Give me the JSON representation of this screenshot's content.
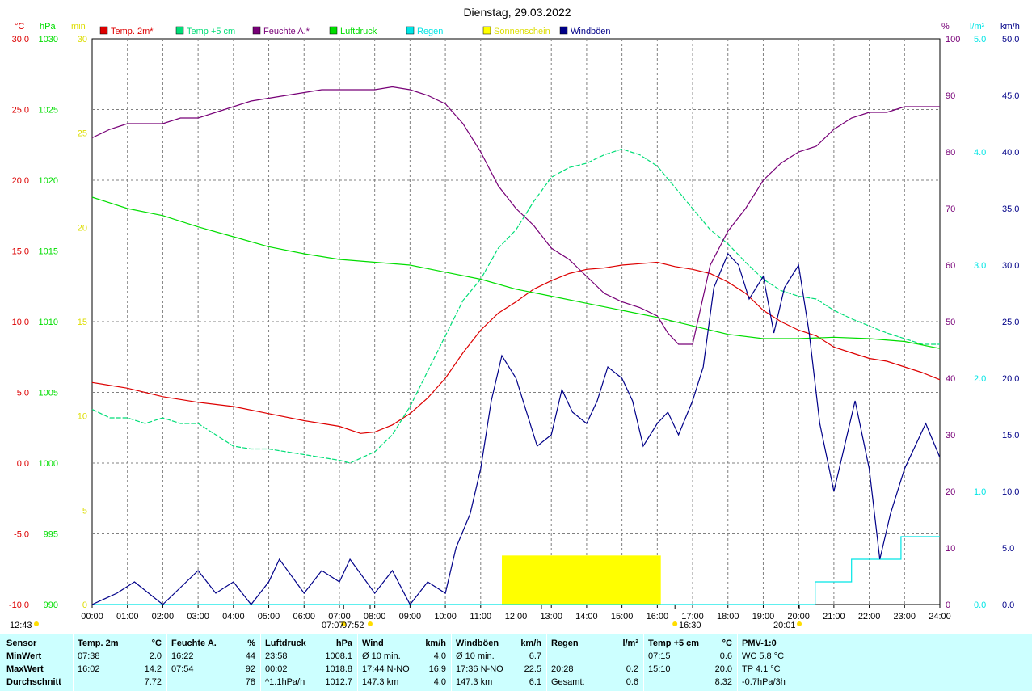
{
  "title": "Dienstag, 29.03.2022",
  "colors": {
    "temp2m": "#dd0000",
    "temp5cm": "#00dd77",
    "humidity": "#770077",
    "pressure": "#00dd00",
    "rain": "#00e5e5",
    "sunshine": "#ffff00",
    "gusts": "#000088",
    "grid": "#808080"
  },
  "axis_labels": {
    "temp_unit": "°C",
    "pressure_unit": "hPa",
    "sun_unit": "min",
    "hum_unit": "%",
    "rain_unit": "l/m²",
    "wind_unit": "km/h"
  },
  "legend": [
    {
      "label": "Temp. 2m*",
      "color": "#dd0000"
    },
    {
      "label": "Temp +5 cm",
      "color": "#00dd77"
    },
    {
      "label": "Feuchte A.*",
      "color": "#770077"
    },
    {
      "label": "Luftdruck",
      "color": "#00dd00"
    },
    {
      "label": "Regen",
      "color": "#00e5e5"
    },
    {
      "label": "Sonnenschein",
      "color": "#ffff00"
    },
    {
      "label": "Windböen",
      "color": "#000088"
    }
  ],
  "ticks": {
    "temp": [
      "30.0",
      "25.0",
      "20.0",
      "15.0",
      "10.0",
      "5.0",
      "0.0",
      "-5.0",
      "-10.0"
    ],
    "pressure": [
      "1030",
      "1025",
      "1020",
      "1015",
      "1010",
      "1005",
      "1000",
      "995",
      "990"
    ],
    "sun": [
      "30",
      "25",
      "20",
      "15",
      "10",
      "5",
      "0"
    ],
    "hum": [
      "100",
      "90",
      "80",
      "70",
      "60",
      "50",
      "40",
      "30",
      "20",
      "10",
      "0"
    ],
    "rain": [
      "5.0",
      "4.0",
      "3.0",
      "2.0",
      "1.0",
      "0.0"
    ],
    "wind": [
      "50.0",
      "45.0",
      "40.0",
      "35.0",
      "30.0",
      "25.0",
      "20.0",
      "15.0",
      "10.0",
      "5.0",
      "0.0"
    ],
    "x": [
      "00:00",
      "01:00",
      "02:00",
      "03:00",
      "04:00",
      "05:00",
      "06:00",
      "07:00",
      "08:00",
      "09:00",
      "10:00",
      "11:00",
      "12:00",
      "13:00",
      "14:00",
      "15:00",
      "16:00",
      "17:00",
      "18:00",
      "19:00",
      "20:00",
      "21:00",
      "22:00",
      "23:00",
      "24:00"
    ]
  },
  "markers": [
    {
      "label": "12:43",
      "hour": 12.72
    },
    {
      "label": "07:07",
      "hour": 7.12
    },
    {
      "label": "07:52",
      "hour": 7.87
    },
    {
      "label": "16:30",
      "hour": 16.5
    },
    {
      "label": "20:01",
      "hour": 20.02
    }
  ],
  "chart_data": {
    "type": "line",
    "title": "Dienstag, 29.03.2022",
    "x_unit": "hour of day",
    "xlim": [
      0,
      24
    ],
    "series": [
      {
        "name": "Temp. 2m*",
        "axis": "temp",
        "ylim": [
          -10,
          30
        ],
        "x": [
          0,
          1,
          2,
          3,
          4,
          5,
          6,
          7,
          7.6,
          8,
          8.5,
          9,
          9.5,
          10,
          10.5,
          11,
          11.5,
          12,
          12.5,
          13,
          13.5,
          14,
          14.5,
          15,
          15.5,
          16,
          16.5,
          17,
          17.5,
          18,
          18.5,
          19,
          19.5,
          20,
          20.5,
          21,
          21.5,
          22,
          22.5,
          23,
          23.5,
          24
        ],
        "y": [
          5.7,
          5.3,
          4.7,
          4.3,
          4.0,
          3.5,
          3.0,
          2.6,
          2.1,
          2.2,
          2.7,
          3.5,
          4.6,
          6.0,
          7.8,
          9.4,
          10.6,
          11.4,
          12.3,
          12.9,
          13.4,
          13.7,
          13.8,
          14.0,
          14.1,
          14.2,
          13.9,
          13.7,
          13.4,
          12.8,
          12.0,
          10.8,
          10.0,
          9.4,
          9.0,
          8.2,
          7.8,
          7.4,
          7.2,
          6.8,
          6.4,
          5.9
        ]
      },
      {
        "name": "Temp +5 cm",
        "axis": "temp",
        "ylim": [
          -10,
          30
        ],
        "x": [
          0,
          0.5,
          1,
          1.5,
          2,
          2.5,
          3,
          3.5,
          4,
          4.5,
          5,
          5.5,
          6,
          6.5,
          7,
          7.3,
          8,
          8.5,
          9,
          9.5,
          10,
          10.5,
          11,
          11.5,
          12,
          12.5,
          13,
          13.5,
          14,
          14.5,
          15,
          15.5,
          16,
          16.5,
          17,
          17.5,
          18,
          18.5,
          19,
          19.5,
          20,
          20.5,
          21,
          21.5,
          22,
          22.5,
          23,
          23.5,
          24
        ],
        "y": [
          3.8,
          3.2,
          3.2,
          2.8,
          3.2,
          2.8,
          2.8,
          2.0,
          1.2,
          1.0,
          1.0,
          0.8,
          0.6,
          0.4,
          0.2,
          0.0,
          0.8,
          2.0,
          4.0,
          6.5,
          9.0,
          11.5,
          13.0,
          15.2,
          16.5,
          18.5,
          20.2,
          20.9,
          21.2,
          21.8,
          22.2,
          21.8,
          21.0,
          19.5,
          18.0,
          16.5,
          15.5,
          14.2,
          13.0,
          12.2,
          11.8,
          11.6,
          10.8,
          10.2,
          9.7,
          9.2,
          8.8,
          8.4,
          8.4
        ]
      },
      {
        "name": "Feuchte A.*",
        "axis": "hum",
        "ylim": [
          0,
          100
        ],
        "x": [
          0,
          0.5,
          1,
          1.5,
          2,
          2.5,
          3,
          3.5,
          4,
          4.5,
          5,
          5.5,
          6,
          6.5,
          7,
          7.5,
          8,
          8.5,
          9,
          9.5,
          10,
          10.5,
          11,
          11.5,
          12,
          12.5,
          13,
          13.5,
          14,
          14.5,
          15,
          15.5,
          16,
          16.3,
          16.6,
          17,
          17.5,
          18,
          18.5,
          19,
          19.5,
          20,
          20.5,
          21,
          21.5,
          22,
          22.5,
          23,
          23.5,
          24
        ],
        "y": [
          82.5,
          84,
          85,
          85,
          85,
          86,
          86,
          87,
          88,
          89,
          89.5,
          90,
          90.5,
          91,
          91,
          91,
          91,
          91.5,
          91,
          90,
          88.5,
          85,
          80,
          74,
          70,
          67,
          63,
          61,
          58,
          55,
          53.5,
          52.5,
          51,
          48,
          46,
          46,
          60,
          66,
          70,
          75,
          78,
          80,
          81,
          84,
          86,
          87,
          87,
          88,
          88,
          88
        ]
      },
      {
        "name": "Luftdruck",
        "axis": "pressure",
        "ylim": [
          990,
          1030
        ],
        "x": [
          0,
          1,
          2,
          3,
          4,
          5,
          6,
          7,
          8,
          9,
          10,
          11,
          12,
          13,
          14,
          15,
          16,
          17,
          18,
          19,
          20,
          21,
          22,
          23,
          24
        ],
        "y": [
          1018.8,
          1018.0,
          1017.5,
          1016.7,
          1016.0,
          1015.3,
          1014.8,
          1014.4,
          1014.2,
          1014.0,
          1013.5,
          1013.0,
          1012.3,
          1011.8,
          1011.3,
          1010.8,
          1010.3,
          1009.7,
          1009.1,
          1008.8,
          1008.8,
          1008.9,
          1008.8,
          1008.6,
          1008.1
        ]
      },
      {
        "name": "Regen",
        "axis": "rain",
        "ylim": [
          0,
          5
        ],
        "x": [
          0,
          20.47,
          20.47,
          21.5,
          21.5,
          22.9,
          22.9,
          24
        ],
        "y": [
          0,
          0,
          0.2,
          0.2,
          0.4,
          0.4,
          0.6,
          0.6
        ]
      },
      {
        "name": "Windböen",
        "axis": "wind",
        "ylim": [
          0,
          50
        ],
        "x": [
          0,
          0.7,
          1.2,
          2,
          3,
          3.5,
          4,
          4.5,
          5,
          5.3,
          6,
          6.5,
          7,
          7.3,
          8,
          8.5,
          9,
          9.5,
          10,
          10.3,
          10.7,
          11,
          11.3,
          11.6,
          12,
          12.3,
          12.6,
          13,
          13.3,
          13.6,
          14,
          14.3,
          14.6,
          15,
          15.3,
          15.6,
          16,
          16.3,
          16.6,
          17,
          17.3,
          17.6,
          18,
          18.3,
          18.6,
          19,
          19.3,
          19.6,
          20,
          20.3,
          20.6,
          21,
          21.3,
          21.6,
          22,
          22.3,
          22.6,
          23,
          23.3,
          23.6,
          24
        ],
        "y": [
          0,
          1,
          2,
          0,
          3,
          1,
          2,
          0,
          2,
          4,
          1,
          3,
          2,
          4,
          1,
          3,
          0,
          2,
          1,
          5,
          8,
          12,
          18,
          22,
          20,
          17,
          14,
          15,
          19,
          17,
          16,
          18,
          21,
          20,
          18,
          14,
          16,
          17,
          15,
          18,
          21,
          28,
          31,
          30,
          27,
          29,
          24,
          28,
          30,
          24,
          16,
          10,
          14,
          18,
          12,
          4,
          8,
          12,
          14,
          16,
          13
        ]
      },
      {
        "name": "Sonnenschein",
        "axis": "sun",
        "ylim": [
          0,
          30
        ],
        "x": [
          11.6,
          16.1
        ],
        "y": [
          2.6,
          2.6
        ]
      }
    ]
  },
  "stats": {
    "columns": [
      {
        "header": [
          "Sensor",
          ""
        ],
        "rows": [
          [
            "MinWert",
            ""
          ],
          [
            "MaxWert",
            ""
          ],
          [
            "Durchschnitt",
            ""
          ]
        ]
      },
      {
        "header": [
          "Temp. 2m",
          "°C"
        ],
        "rows": [
          [
            "07:38",
            "2.0"
          ],
          [
            "16:02",
            "14.2"
          ],
          [
            "",
            "7.72"
          ]
        ]
      },
      {
        "header": [
          "Feuchte A.",
          "%"
        ],
        "rows": [
          [
            "16:22",
            "44"
          ],
          [
            "07:54",
            "92"
          ],
          [
            "",
            "78"
          ]
        ]
      },
      {
        "header": [
          "Luftdruck",
          "hPa"
        ],
        "rows": [
          [
            "23:58",
            "1008.1"
          ],
          [
            "00:02",
            "1018.8"
          ],
          [
            "^1.1hPa/h",
            "1012.7"
          ]
        ]
      },
      {
        "header": [
          "Wind",
          "km/h"
        ],
        "rows": [
          [
            "Ø 10 min.",
            "4.0"
          ],
          [
            "17:44   N-NO",
            "16.9"
          ],
          [
            "147.3 km",
            "4.0"
          ]
        ]
      },
      {
        "header": [
          "Windböen",
          "km/h"
        ],
        "rows": [
          [
            "Ø 10 min.",
            "6.7"
          ],
          [
            "17:36   N-NO",
            "22.5"
          ],
          [
            "147.3 km",
            "6.1"
          ]
        ]
      },
      {
        "header": [
          "Regen",
          "l/m²"
        ],
        "rows": [
          [
            "",
            ""
          ],
          [
            "20:28",
            "0.2"
          ],
          [
            "Gesamt:",
            "0.6"
          ]
        ]
      },
      {
        "header": [
          "Temp +5 cm",
          "°C"
        ],
        "rows": [
          [
            "07:15",
            "0.6"
          ],
          [
            "15:10",
            "20.0"
          ],
          [
            "",
            "8.32"
          ]
        ]
      },
      {
        "header": [
          "PMV-1:0",
          ""
        ],
        "rows": [
          [
            "WC 5.8 °C",
            ""
          ],
          [
            "TP 4.1 °C",
            ""
          ],
          [
            "-0.7hPa/3h",
            ""
          ]
        ]
      }
    ]
  }
}
